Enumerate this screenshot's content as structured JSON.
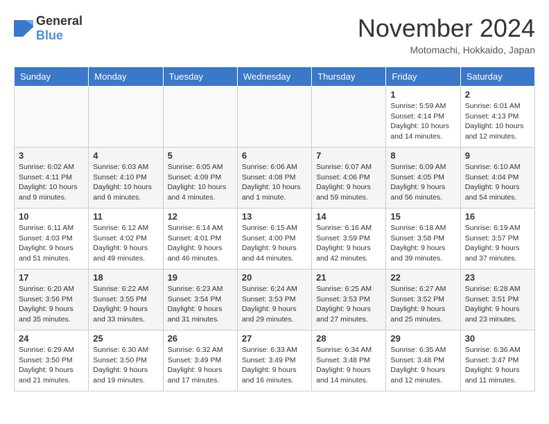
{
  "header": {
    "logo_general": "General",
    "logo_blue": "Blue",
    "month_title": "November 2024",
    "location": "Motomachi, Hokkaido, Japan"
  },
  "days_of_week": [
    "Sunday",
    "Monday",
    "Tuesday",
    "Wednesday",
    "Thursday",
    "Friday",
    "Saturday"
  ],
  "weeks": [
    [
      {
        "day": "",
        "info": ""
      },
      {
        "day": "",
        "info": ""
      },
      {
        "day": "",
        "info": ""
      },
      {
        "day": "",
        "info": ""
      },
      {
        "day": "",
        "info": ""
      },
      {
        "day": "1",
        "info": "Sunrise: 5:59 AM\nSunset: 4:14 PM\nDaylight: 10 hours and 14 minutes."
      },
      {
        "day": "2",
        "info": "Sunrise: 6:01 AM\nSunset: 4:13 PM\nDaylight: 10 hours and 12 minutes."
      }
    ],
    [
      {
        "day": "3",
        "info": "Sunrise: 6:02 AM\nSunset: 4:11 PM\nDaylight: 10 hours and 9 minutes."
      },
      {
        "day": "4",
        "info": "Sunrise: 6:03 AM\nSunset: 4:10 PM\nDaylight: 10 hours and 6 minutes."
      },
      {
        "day": "5",
        "info": "Sunrise: 6:05 AM\nSunset: 4:09 PM\nDaylight: 10 hours and 4 minutes."
      },
      {
        "day": "6",
        "info": "Sunrise: 6:06 AM\nSunset: 4:08 PM\nDaylight: 10 hours and 1 minute."
      },
      {
        "day": "7",
        "info": "Sunrise: 6:07 AM\nSunset: 4:06 PM\nDaylight: 9 hours and 59 minutes."
      },
      {
        "day": "8",
        "info": "Sunrise: 6:09 AM\nSunset: 4:05 PM\nDaylight: 9 hours and 56 minutes."
      },
      {
        "day": "9",
        "info": "Sunrise: 6:10 AM\nSunset: 4:04 PM\nDaylight: 9 hours and 54 minutes."
      }
    ],
    [
      {
        "day": "10",
        "info": "Sunrise: 6:11 AM\nSunset: 4:03 PM\nDaylight: 9 hours and 51 minutes."
      },
      {
        "day": "11",
        "info": "Sunrise: 6:12 AM\nSunset: 4:02 PM\nDaylight: 9 hours and 49 minutes."
      },
      {
        "day": "12",
        "info": "Sunrise: 6:14 AM\nSunset: 4:01 PM\nDaylight: 9 hours and 46 minutes."
      },
      {
        "day": "13",
        "info": "Sunrise: 6:15 AM\nSunset: 4:00 PM\nDaylight: 9 hours and 44 minutes."
      },
      {
        "day": "14",
        "info": "Sunrise: 6:16 AM\nSunset: 3:59 PM\nDaylight: 9 hours and 42 minutes."
      },
      {
        "day": "15",
        "info": "Sunrise: 6:18 AM\nSunset: 3:58 PM\nDaylight: 9 hours and 39 minutes."
      },
      {
        "day": "16",
        "info": "Sunrise: 6:19 AM\nSunset: 3:57 PM\nDaylight: 9 hours and 37 minutes."
      }
    ],
    [
      {
        "day": "17",
        "info": "Sunrise: 6:20 AM\nSunset: 3:56 PM\nDaylight: 9 hours and 35 minutes."
      },
      {
        "day": "18",
        "info": "Sunrise: 6:22 AM\nSunset: 3:55 PM\nDaylight: 9 hours and 33 minutes."
      },
      {
        "day": "19",
        "info": "Sunrise: 6:23 AM\nSunset: 3:54 PM\nDaylight: 9 hours and 31 minutes."
      },
      {
        "day": "20",
        "info": "Sunrise: 6:24 AM\nSunset: 3:53 PM\nDaylight: 9 hours and 29 minutes."
      },
      {
        "day": "21",
        "info": "Sunrise: 6:25 AM\nSunset: 3:53 PM\nDaylight: 9 hours and 27 minutes."
      },
      {
        "day": "22",
        "info": "Sunrise: 6:27 AM\nSunset: 3:52 PM\nDaylight: 9 hours and 25 minutes."
      },
      {
        "day": "23",
        "info": "Sunrise: 6:28 AM\nSunset: 3:51 PM\nDaylight: 9 hours and 23 minutes."
      }
    ],
    [
      {
        "day": "24",
        "info": "Sunrise: 6:29 AM\nSunset: 3:50 PM\nDaylight: 9 hours and 21 minutes."
      },
      {
        "day": "25",
        "info": "Sunrise: 6:30 AM\nSunset: 3:50 PM\nDaylight: 9 hours and 19 minutes."
      },
      {
        "day": "26",
        "info": "Sunrise: 6:32 AM\nSunset: 3:49 PM\nDaylight: 9 hours and 17 minutes."
      },
      {
        "day": "27",
        "info": "Sunrise: 6:33 AM\nSunset: 3:49 PM\nDaylight: 9 hours and 16 minutes."
      },
      {
        "day": "28",
        "info": "Sunrise: 6:34 AM\nSunset: 3:48 PM\nDaylight: 9 hours and 14 minutes."
      },
      {
        "day": "29",
        "info": "Sunrise: 6:35 AM\nSunset: 3:48 PM\nDaylight: 9 hours and 12 minutes."
      },
      {
        "day": "30",
        "info": "Sunrise: 6:36 AM\nSunset: 3:47 PM\nDaylight: 9 hours and 11 minutes."
      }
    ]
  ]
}
